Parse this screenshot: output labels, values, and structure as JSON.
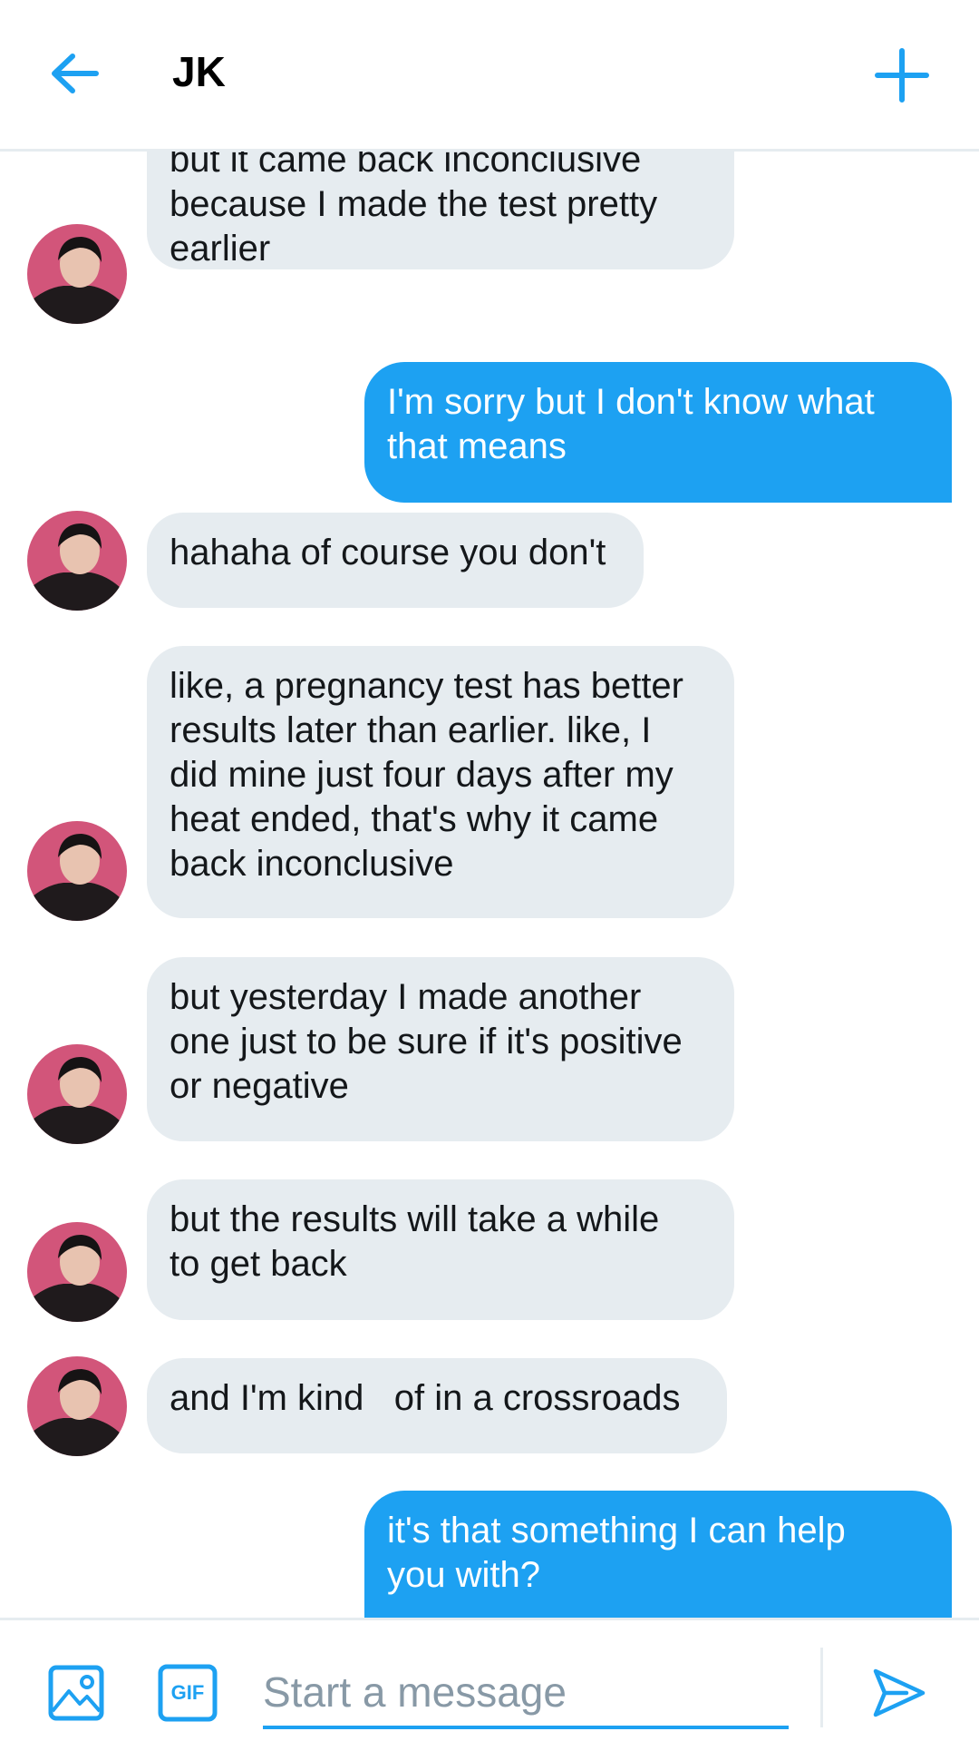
{
  "header": {
    "title": "JK",
    "back_icon": "arrow-left-icon",
    "new_icon": "plus-icon",
    "accent": "#1da1f2"
  },
  "conversation": {
    "messages": [
      {
        "side": "in",
        "text": "but it came back inconclusive\nbecause I made the test pretty\nearlier"
      },
      {
        "side": "out",
        "text": "I'm sorry but I don't know what\nthat means"
      },
      {
        "side": "in",
        "text": "hahaha of course you don't"
      },
      {
        "side": "in",
        "text": "like, a pregnancy test has better\nresults later than earlier. like, I\ndid mine just four days after my\nheat ended, that's why it came\nback inconclusive"
      },
      {
        "side": "in",
        "text": "but yesterday I made another\none just to be sure if it's positive\nor negative"
      },
      {
        "side": "in",
        "text": "but the results will take a while\nto get back"
      },
      {
        "side": "in",
        "text": "and I'm kind   of in a crossroads"
      },
      {
        "side": "out",
        "text": "it's that something I can help\nyou with?"
      }
    ],
    "incoming_bg": "#e6ecf0",
    "outgoing_bg": "#1da1f2"
  },
  "composer": {
    "placeholder": "Start a message",
    "gif_label": "GIF",
    "media_icon": "image-icon",
    "send_icon": "send-icon"
  }
}
